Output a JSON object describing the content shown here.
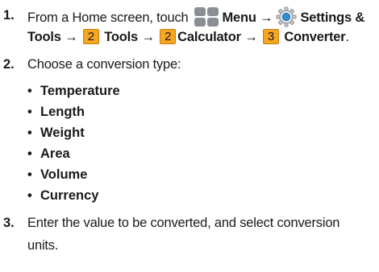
{
  "steps": [
    {
      "number": "1.",
      "line1": {
        "prefix": "From a Home screen, touch",
        "menu_label": "Menu",
        "arrow1": "→",
        "settings_label": "Settings &"
      },
      "line2": {
        "tools_prefix": "Tools",
        "arrow2": "→",
        "key_tools": "2",
        "tools_label": "Tools",
        "arrow3": "→",
        "key_calc": "2",
        "calc_label": "Calculator",
        "arrow4": "→",
        "key_conv": "3",
        "conv_label": "Converter",
        "end": "."
      }
    },
    {
      "number": "2.",
      "text": "Choose a conversion type:",
      "bullet": "•",
      "options": [
        "Temperature",
        "Length",
        "Weight",
        "Area",
        "Volume",
        "Currency"
      ]
    },
    {
      "number": "3.",
      "line1": "Enter the value to be converted, and select conversion",
      "line2": "units."
    }
  ],
  "icons": {
    "menu": "menu-grid-icon",
    "settings": "settings-gear-icon"
  },
  "colors": {
    "key_fill": "#f6a623",
    "icon_tile": "#8b8f95"
  }
}
